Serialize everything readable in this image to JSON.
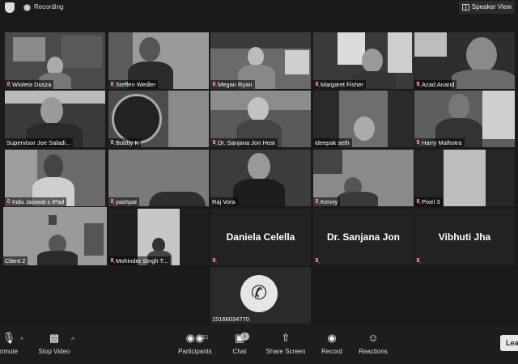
{
  "topbar": {
    "recording_label": "Recording",
    "speaker_view_label": "Speaker View"
  },
  "participants": [
    {
      "name": "Wioleta Dusza"
    },
    {
      "name": "Steffen Wedler"
    },
    {
      "name": "Megan Ryan"
    },
    {
      "name": "Margaret Fisher"
    },
    {
      "name": "Azad Anand"
    },
    {
      "name": "Supervisor Joe Saladi..."
    },
    {
      "name": "Bobby K"
    },
    {
      "name": "Dr. Sanjana Jon Host"
    },
    {
      "name": "ideepak seth"
    },
    {
      "name": "Harry Malhotra"
    },
    {
      "name": "Indu Jaiswal s iPad"
    },
    {
      "name": "yashpal"
    },
    {
      "name": "Raj Vora"
    },
    {
      "name": "Kenny"
    },
    {
      "name": "Pixel 3"
    },
    {
      "name": "Client 2"
    },
    {
      "name": "Mohinder Singh T..."
    },
    {
      "name": "Daniela Celella"
    },
    {
      "name": "Dr. Sanjana Jon"
    },
    {
      "name": "Vibhuti Jha"
    },
    {
      "name": "15166034770"
    }
  ],
  "toolbar": {
    "unmute_label": "nmute",
    "stop_video_label": "Stop Video",
    "participants_label": "Participants",
    "participants_count": "21",
    "chat_label": "Chat",
    "chat_badge": "1",
    "share_screen_label": "Share Screen",
    "record_label": "Record",
    "reactions_label": "Reactions",
    "leave_label": "Lea"
  },
  "colors": {
    "background": "#1a1a1a",
    "tile": "#2a2a2a",
    "active_border": "#eaeaea"
  }
}
